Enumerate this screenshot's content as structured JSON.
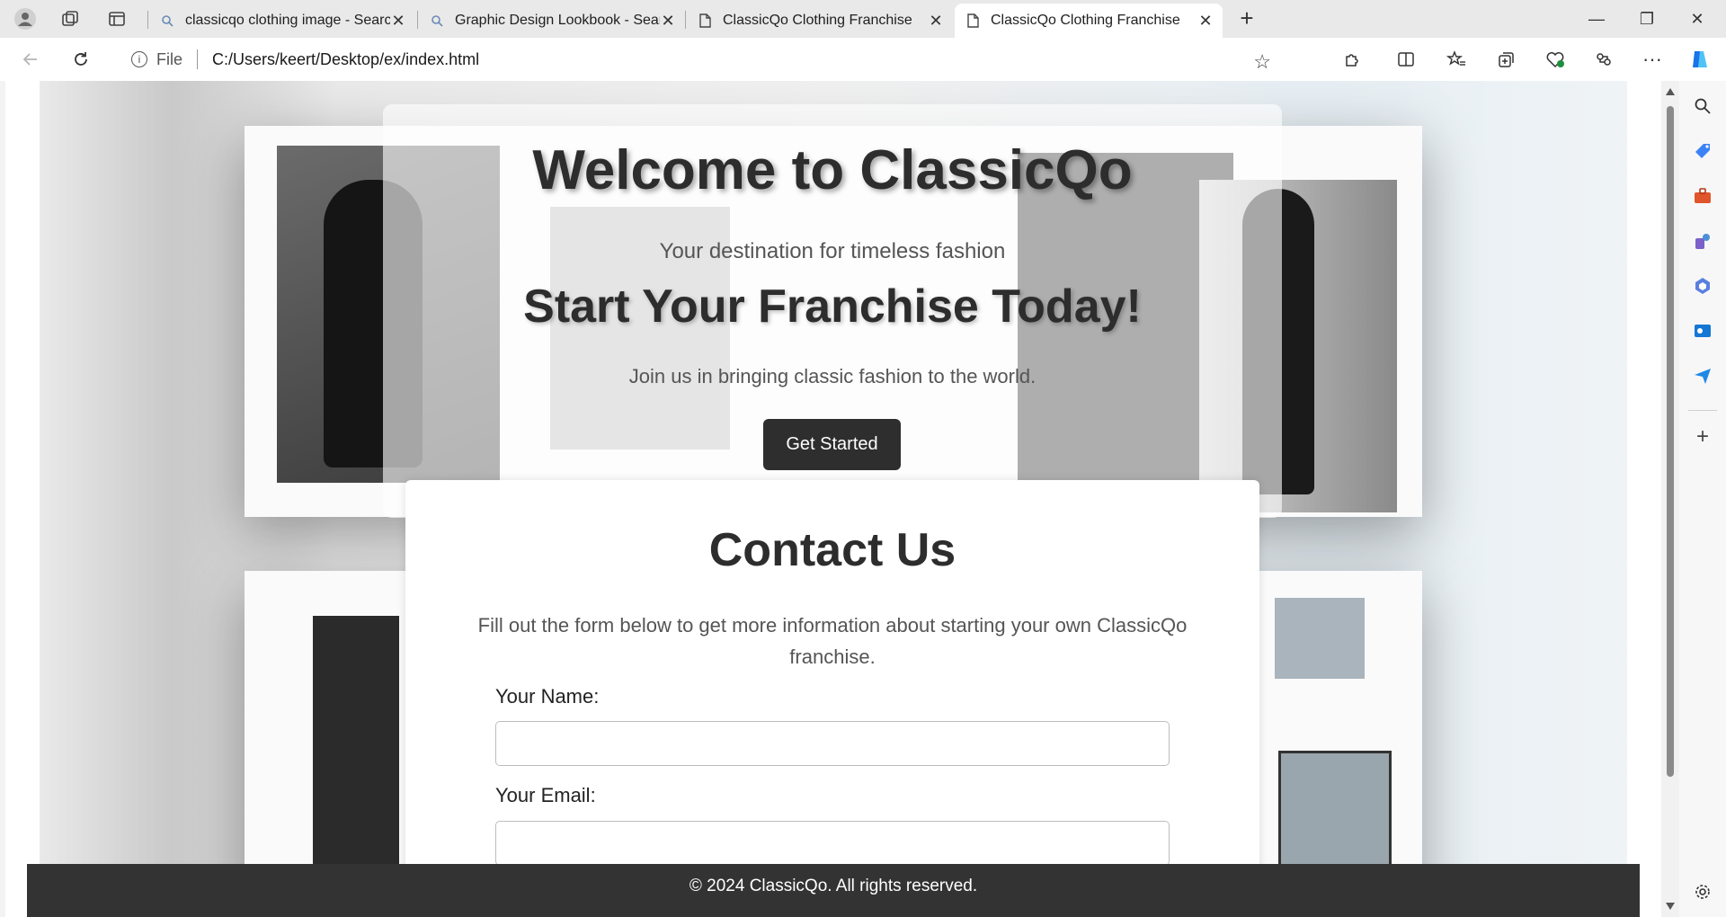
{
  "browser": {
    "tabs": [
      {
        "title": "classicqo clothing image - Search",
        "icon": "search-icon",
        "active": false
      },
      {
        "title": "Graphic Design Lookbook - Search",
        "icon": "search-icon",
        "active": false
      },
      {
        "title": "ClassicQo Clothing Franchise",
        "icon": "page-icon",
        "active": false
      },
      {
        "title": "ClassicQo Clothing Franchise",
        "icon": "page-icon",
        "active": true
      }
    ],
    "new_tab": "+",
    "window_controls": {
      "minimize": "—",
      "restore": "❐",
      "close": "✕"
    },
    "address": {
      "scheme_label": "File",
      "url": "C:/Users/keert/Desktop/ex/index.html"
    }
  },
  "page": {
    "hero": {
      "title": "Welcome to ClassicQo",
      "tagline": "Your destination for timeless fashion",
      "headline": "Start Your Franchise Today!",
      "subtext": "Join us in bringing classic fashion to the world.",
      "cta_label": "Get Started"
    },
    "contact": {
      "title": "Contact Us",
      "lead": "Fill out the form below to get more information about starting your own ClassicQo franchise.",
      "name_label": "Your Name:",
      "email_label": "Your Email:",
      "name_value": "",
      "email_value": ""
    },
    "footer": {
      "text": "© 2024 ClassicQo. All rights reserved."
    }
  },
  "colors": {
    "dark": "#2e2e2e",
    "text_gray": "#555555",
    "edge_accent": "#1a73e8"
  }
}
